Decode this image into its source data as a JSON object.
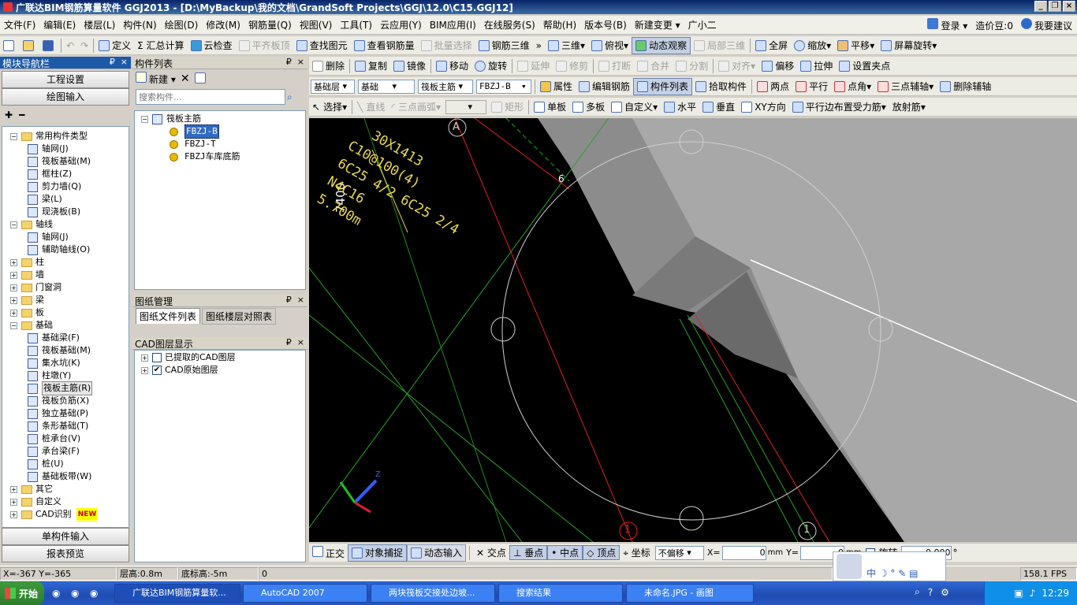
{
  "window": {
    "title": "广联达BIM钢筋算量软件 GGJ2013 - [D:\\MyBackup\\我的文档\\GrandSoft Projects\\GGJ\\12.0\\C15.GGJ12]",
    "min": "_",
    "max": "❐",
    "close": "×"
  },
  "menu": [
    "文件(F)",
    "编辑(E)",
    "楼层(L)",
    "构件(N)",
    "绘图(D)",
    "修改(M)",
    "钢筋量(Q)",
    "视图(V)",
    "工具(T)",
    "云应用(Y)",
    "BIM应用(I)",
    "在线服务(S)",
    "帮助(H)",
    "版本号(B)",
    "新建变更 ▾",
    "广小二"
  ],
  "menu_right": {
    "login": "登录 ▾",
    "price": "造价豆:0",
    "suggest": "我要建议"
  },
  "tb1": {
    "define": "定义",
    "sum": "Σ 汇总计算",
    "cloud_check": "云检查",
    "align_top": "平齐板顶",
    "find": "查找图元",
    "view_rebar": "查看钢筋量",
    "batch": "批量选择",
    "rebar3d": "钢筋三维",
    "view3d": "三维",
    "top": "俯视",
    "dynamic": "动态观察",
    "local3d": "局部三维",
    "full": "全屏",
    "zoom": "缩放",
    "pan": "平移",
    "rotate": "屏幕旋转"
  },
  "tb2": {
    "delete": "删除",
    "copy": "复制",
    "mirror": "镜像",
    "move": "移动",
    "rotate": "旋转",
    "extend": "延伸",
    "trim": "修剪",
    "break": "打断",
    "merge": "合并",
    "split": "分割",
    "align": "对齐",
    "offset": "偏移",
    "stretch": "拉伸",
    "grip": "设置夹点"
  },
  "tb3": {
    "layer": "基础层",
    "category": "基础",
    "type": "筏板主筋",
    "name": "FBZJ-B",
    "prop": "属性",
    "edit_rebar": "编辑钢筋",
    "comp_list": "构件列表",
    "pick": "拾取构件",
    "two_pt": "两点",
    "parallel": "平行",
    "pt_angle": "点角",
    "three_pt": "三点辅轴",
    "del_aux": "删除辅轴"
  },
  "tb4": {
    "select": "选择",
    "line": "直线",
    "arc": "三点画弧",
    "rect": "矩形",
    "single": "单板",
    "multi": "多板",
    "custom": "自定义",
    "horiz": "水平",
    "vert": "垂直",
    "xy": "XY方向",
    "parallel_edge": "平行边布置受力筋",
    "radial": "放射筋"
  },
  "nav": {
    "title": "模块导航栏",
    "pin": "₽",
    "close": "×",
    "project": "工程设置",
    "draw": "绘图输入",
    "single": "单构件输入",
    "report": "报表预览"
  },
  "tree": [
    {
      "lvl": 0,
      "pm": "−",
      "type": "folder",
      "label": "常用构件类型"
    },
    {
      "lvl": 1,
      "type": "leaf",
      "label": "轴网(J)"
    },
    {
      "lvl": 1,
      "type": "leaf",
      "label": "筏板基础(M)"
    },
    {
      "lvl": 1,
      "type": "leaf",
      "label": "框柱(Z)"
    },
    {
      "lvl": 1,
      "type": "leaf",
      "label": "剪力墙(Q)"
    },
    {
      "lvl": 1,
      "type": "leaf",
      "label": "梁(L)"
    },
    {
      "lvl": 1,
      "type": "leaf",
      "label": "现浇板(B)"
    },
    {
      "lvl": 0,
      "pm": "−",
      "type": "folder",
      "label": "轴线"
    },
    {
      "lvl": 1,
      "type": "leaf",
      "label": "轴网(J)"
    },
    {
      "lvl": 1,
      "type": "leaf",
      "label": "辅助轴线(O)"
    },
    {
      "lvl": 0,
      "pm": "+",
      "type": "folder",
      "label": "柱"
    },
    {
      "lvl": 0,
      "pm": "+",
      "type": "folder",
      "label": "墙"
    },
    {
      "lvl": 0,
      "pm": "+",
      "type": "folder",
      "label": "门窗洞"
    },
    {
      "lvl": 0,
      "pm": "+",
      "type": "folder",
      "label": "梁"
    },
    {
      "lvl": 0,
      "pm": "+",
      "type": "folder",
      "label": "板"
    },
    {
      "lvl": 0,
      "pm": "−",
      "type": "folder",
      "label": "基础"
    },
    {
      "lvl": 1,
      "type": "leaf",
      "label": "基础梁(F)"
    },
    {
      "lvl": 1,
      "type": "leaf",
      "label": "筏板基础(M)"
    },
    {
      "lvl": 1,
      "type": "leaf",
      "label": "集水坑(K)"
    },
    {
      "lvl": 1,
      "type": "leaf",
      "label": "柱墩(Y)"
    },
    {
      "lvl": 1,
      "type": "leaf",
      "label": "筏板主筋(R)",
      "sel": true
    },
    {
      "lvl": 1,
      "type": "leaf",
      "label": "筏板负筋(X)"
    },
    {
      "lvl": 1,
      "type": "leaf",
      "label": "独立基础(P)"
    },
    {
      "lvl": 1,
      "type": "leaf",
      "label": "条形基础(T)"
    },
    {
      "lvl": 1,
      "type": "leaf",
      "label": "桩承台(V)"
    },
    {
      "lvl": 1,
      "type": "leaf",
      "label": "承台梁(F)"
    },
    {
      "lvl": 1,
      "type": "leaf",
      "label": "桩(U)"
    },
    {
      "lvl": 1,
      "type": "leaf",
      "label": "基础板带(W)"
    },
    {
      "lvl": 0,
      "pm": "+",
      "type": "folder",
      "label": "其它"
    },
    {
      "lvl": 0,
      "pm": "+",
      "type": "folder",
      "label": "自定义"
    },
    {
      "lvl": 0,
      "pm": "+",
      "type": "folder",
      "label": "CAD识别",
      "badge": "NEW"
    }
  ],
  "comp": {
    "title": "构件列表",
    "new": "新建 ▾",
    "search_ph": "搜索构件...",
    "root": "筏板主筋",
    "items": [
      "FBZJ-B",
      "FBZJ-T",
      "FBZJ车库底筋"
    ]
  },
  "drawings": {
    "title": "图纸管理",
    "tab1": "图纸文件列表",
    "tab2": "图纸楼层对照表"
  },
  "cadlayers": {
    "title": "CAD图层显示",
    "items": [
      {
        "label": "已提取的CAD图层",
        "checked": false
      },
      {
        "label": "CAD原始图层",
        "checked": true
      }
    ]
  },
  "canvas": {
    "dim": "7400",
    "axis_a": "A",
    "axis_1a": "1",
    "axis_1b": "1",
    "partial": "6",
    "cad_lines": [
      "30X1413",
      "C10@100(4)",
      "6C25 4/2 6C25 2/4",
      "N4C16",
      "5.700m"
    ]
  },
  "bottom": {
    "ortho": "正交",
    "snap": "对象捕捉",
    "dyn": "动态输入",
    "inter": "交点",
    "perp": "垂点",
    "mid": "中点",
    "vertex": "顶点",
    "coord": "坐标",
    "offset": "不偏移",
    "x_label": "X=",
    "x_val": "0",
    "y_label": "Y=",
    "y_val": "0",
    "mm": "mm",
    "rot": "旋转",
    "rot_val": "0.000",
    "deg": "°"
  },
  "status": {
    "coords": "X=-367 Y=-365",
    "floor_h": "层高:0.8m",
    "bottom_h": "底标高:-5m",
    "val": "0",
    "fps": "158.1 FPS"
  },
  "taskbar": {
    "start": "开始",
    "tasks": [
      "广联达BIM钢筋算量软...",
      "AutoCAD 2007",
      "两块筏板交接处边坡...",
      "搜索结果",
      "未命名.JPG - 画图"
    ],
    "time": "12:29"
  }
}
